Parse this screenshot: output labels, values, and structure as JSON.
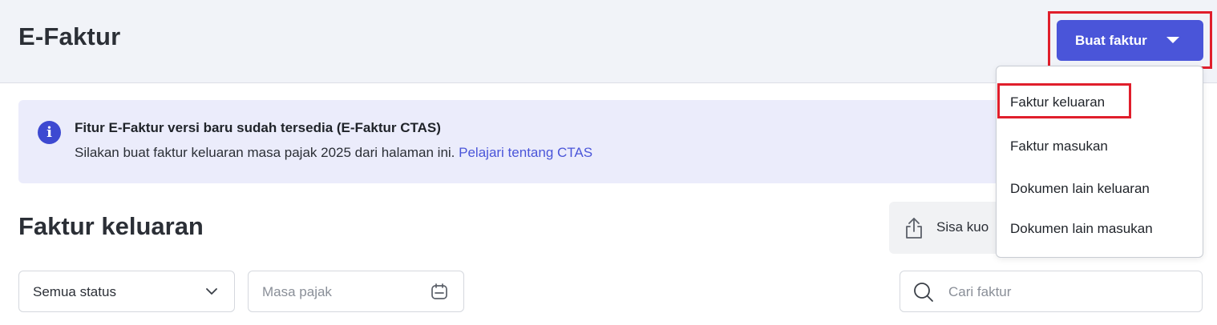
{
  "header": {
    "title": "E-Faktur",
    "create_button_label": "Buat faktur"
  },
  "banner": {
    "title": "Fitur E-Faktur versi baru sudah tersedia (E-Faktur CTAS)",
    "text": "Silakan buat faktur keluaran masa pajak 2025 dari halaman ini.",
    "link": "Pelajari tentang CTAS"
  },
  "section": {
    "title": "Faktur keluaran",
    "quota_label": "Sisa kuo"
  },
  "filters": {
    "status_value": "Semua status",
    "period_placeholder": "Masa pajak",
    "search_placeholder": "Cari faktur"
  },
  "dropdown": {
    "items": [
      "Faktur keluaran",
      "Faktur masukan",
      "Dokumen lain keluaran",
      "Dokumen lain masukan"
    ]
  },
  "colors": {
    "accent": "#4a55d9",
    "banner_bg": "#ebecfb",
    "highlight": "#e01e2b"
  },
  "icons": [
    "info-icon",
    "chevron-down-icon",
    "upload-icon",
    "calendar-icon",
    "search-icon",
    "caret-down-icon"
  ]
}
